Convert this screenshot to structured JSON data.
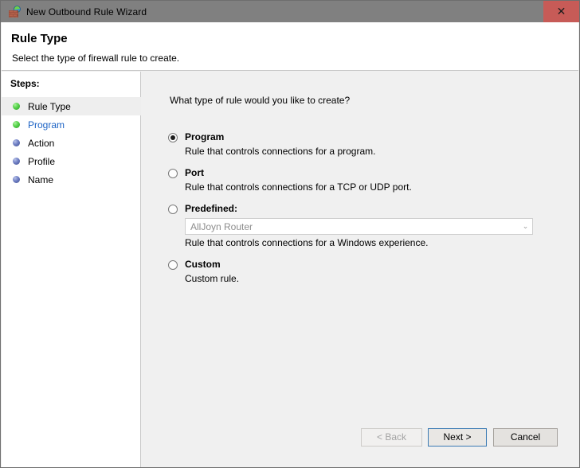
{
  "window": {
    "title": "New Outbound Rule Wizard",
    "icon": "firewall-brick-globe-icon",
    "close_label": "✕",
    "accent_close_color": "#c75b57"
  },
  "header": {
    "title": "Rule Type",
    "subtitle": "Select the type of firewall rule to create."
  },
  "sidebar": {
    "heading": "Steps:",
    "items": [
      {
        "label": "Rule Type",
        "bullet": "green",
        "current": true,
        "link": false
      },
      {
        "label": "Program",
        "bullet": "green",
        "current": false,
        "link": true
      },
      {
        "label": "Action",
        "bullet": "blue",
        "current": false,
        "link": false
      },
      {
        "label": "Profile",
        "bullet": "blue",
        "current": false,
        "link": false
      },
      {
        "label": "Name",
        "bullet": "blue",
        "current": false,
        "link": false
      }
    ]
  },
  "main": {
    "question": "What type of rule would you like to create?",
    "options": [
      {
        "id": "program",
        "label": "Program",
        "description": "Rule that controls connections for a program.",
        "selected": true
      },
      {
        "id": "port",
        "label": "Port",
        "description": "Rule that controls connections for a TCP or UDP port.",
        "selected": false
      },
      {
        "id": "predefined",
        "label": "Predefined:",
        "description": "Rule that controls connections for a Windows experience.",
        "selected": false,
        "combo_value": "AllJoyn Router",
        "combo_arrow": "⌄"
      },
      {
        "id": "custom",
        "label": "Custom",
        "description": "Custom rule.",
        "selected": false
      }
    ]
  },
  "footer": {
    "back_label": "< Back",
    "next_label": "Next >",
    "cancel_label": "Cancel"
  }
}
